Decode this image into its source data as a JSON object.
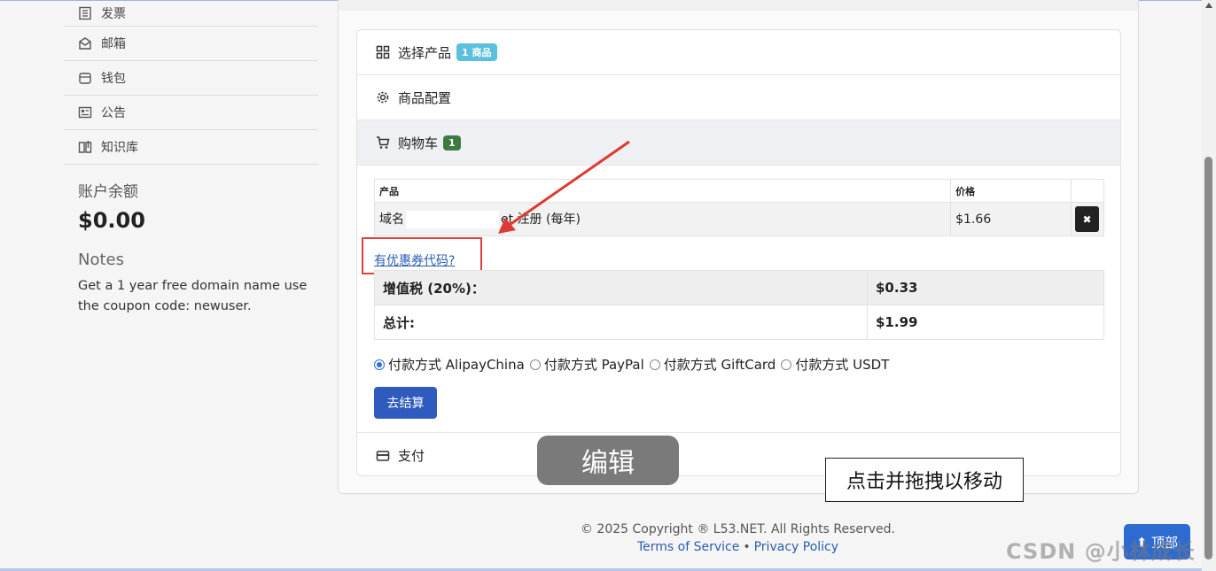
{
  "sidebar": {
    "items": [
      {
        "label": "发票",
        "icon": "invoice-icon"
      },
      {
        "label": "邮箱",
        "icon": "mail-icon"
      },
      {
        "label": "钱包",
        "icon": "wallet-icon"
      },
      {
        "label": "公告",
        "icon": "announcement-icon"
      },
      {
        "label": "知识库",
        "icon": "book-icon"
      }
    ],
    "balance_title": "账户余额",
    "balance_value": "$0.00",
    "notes_title": "Notes",
    "notes_text": "Get a 1 year free domain name use the coupon code: newuser."
  },
  "checkout": {
    "sections": {
      "select_product": {
        "label": "选择产品",
        "badge": "1 商品"
      },
      "config": {
        "label": "商品配置"
      },
      "cart": {
        "label": "购物车",
        "badge": "1"
      },
      "payment": {
        "label": "支付"
      }
    },
    "table": {
      "headers": [
        "产品",
        "价格"
      ],
      "rows": [
        {
          "product_prefix": "域名",
          "product_suffix": "et 注册 (每年)",
          "price": "$1.66"
        }
      ]
    },
    "coupon_link": "有优惠券代码?",
    "totals": [
      {
        "label": "增值税 (20%)：",
        "value": "$0.33"
      },
      {
        "label": "总计:",
        "value": "$1.99"
      }
    ],
    "payment_methods": [
      {
        "label": "付款方式 AlipayChina",
        "selected": true
      },
      {
        "label": "付款方式 PayPal",
        "selected": false
      },
      {
        "label": "付款方式 GiftCard",
        "selected": false
      },
      {
        "label": "付款方式 USDT",
        "selected": false
      }
    ],
    "checkout_button": "去结算"
  },
  "overlay": {
    "edit_label": "编辑",
    "drag_tip": "点击并拖拽以移动"
  },
  "footer": {
    "copyright": "© 2025 Copyright ® L53.NET. All Rights Reserved.",
    "terms": "Terms of Service",
    "privacy": "Privacy Policy"
  },
  "back_to_top": "⬆ 顶部",
  "watermark": "CSDN @小林成长记",
  "colors": {
    "accent": "#2e5bbd",
    "annotation_red": "#e04040",
    "badge_info": "#5bc0de",
    "badge_green": "#3e7b44"
  }
}
